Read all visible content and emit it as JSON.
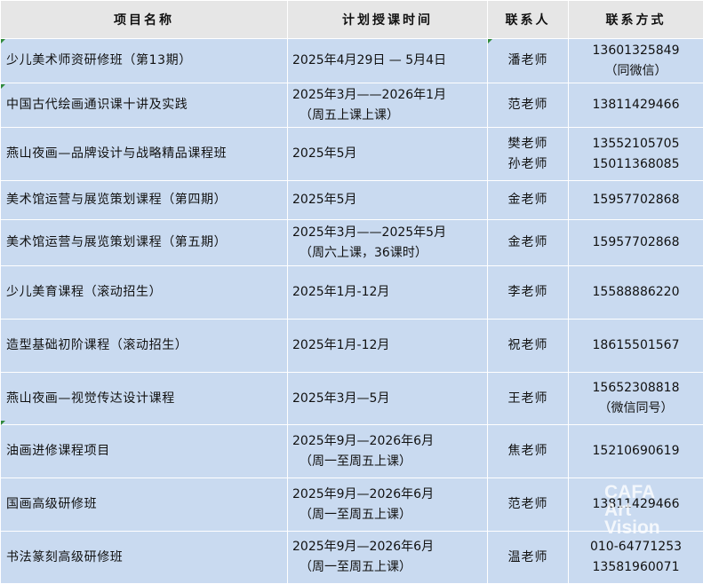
{
  "table": {
    "headers": [
      "项目名称",
      "计划授课时间",
      "联系人",
      "联系方式"
    ],
    "rows": [
      {
        "name": "少儿美术师资研修班（第13期）",
        "time": [
          "2025年4月29日 — 5月4日"
        ],
        "contact": [
          "潘老师"
        ],
        "method": [
          "13601325849",
          "（同微信）"
        ]
      },
      {
        "name": "中国古代绘画通识课十讲及实践",
        "time": [
          "2025年3月——2026年1月",
          "（周五上课上课）"
        ],
        "contact": [
          "范老师"
        ],
        "method": [
          "13811429466"
        ]
      },
      {
        "name": "燕山夜画—品牌设计与战略精品课程班",
        "time": [
          "2025年5月"
        ],
        "contact": [
          "樊老师",
          "孙老师"
        ],
        "method": [
          "13552105705",
          "15011368085"
        ]
      },
      {
        "name": "美术馆运营与展览策划课程（第四期）",
        "time": [
          "2025年5月"
        ],
        "contact": [
          "金老师"
        ],
        "method": [
          "15957702868"
        ]
      },
      {
        "name": "美术馆运营与展览策划课程（第五期）",
        "time": [
          "2025年3月——2025年5月",
          "（周六上课，36课时）"
        ],
        "contact": [
          "金老师"
        ],
        "method": [
          "15957702868"
        ]
      },
      {
        "name": "少儿美育课程（滚动招生）",
        "time": [
          "2025年1月-12月"
        ],
        "contact": [
          "李老师"
        ],
        "method": [
          "15588886220"
        ]
      },
      {
        "name": "造型基础初阶课程（滚动招生）",
        "time": [
          "2025年1月-12月"
        ],
        "contact": [
          "祝老师"
        ],
        "method": [
          "18615501567"
        ]
      },
      {
        "name": "燕山夜画—视觉传达设计课程",
        "time": [
          "2025年3月—5月"
        ],
        "contact": [
          "王老师"
        ],
        "method": [
          "15652308818",
          "（微信同号）"
        ]
      },
      {
        "name": "油画进修课程项目",
        "time": [
          "2025年9月—2026年6月",
          "（周一至周五上课）"
        ],
        "contact": [
          "焦老师"
        ],
        "method": [
          "15210690619"
        ]
      },
      {
        "name": "国画高级研修班",
        "time": [
          "2025年9月—2026年6月",
          "（周一至周五上课）"
        ],
        "contact": [
          "范老师"
        ],
        "method": [
          "13811429466"
        ]
      },
      {
        "name": "书法篆刻高级研修班",
        "time": [
          "2025年9月—2026年6月",
          "（周一至周五上课）"
        ],
        "contact": [
          "温老师"
        ],
        "method": [
          "010-64771253",
          "13581960071"
        ]
      }
    ]
  },
  "watermark": [
    "CAFA",
    "Art",
    "Vision"
  ],
  "colors": {
    "header_bg": "#e6e6e6",
    "row_bg": "#c9daf0",
    "border": "#ffffff",
    "corner_mark": "#2f8a3a"
  }
}
